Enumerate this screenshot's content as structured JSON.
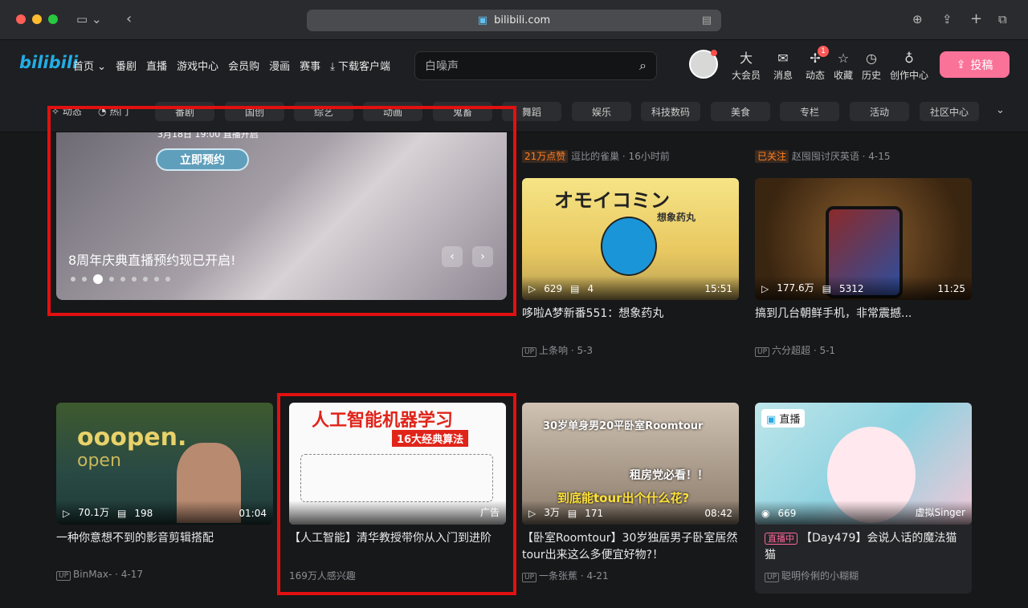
{
  "browser": {
    "url": "bilibili.com"
  },
  "header": {
    "logo": "bilibili",
    "nav": [
      "首页 ⌄",
      "番剧",
      "直播",
      "游戏中心",
      "会员购",
      "漫画",
      "赛事",
      "下载客户端"
    ],
    "search_placeholder": "白噪声",
    "tools": [
      {
        "label": "大会员",
        "icon": "大"
      },
      {
        "label": "消息",
        "icon": "✉"
      },
      {
        "label": "动态",
        "icon": "✢",
        "badge": "1"
      },
      {
        "label": "收藏",
        "icon": "☆"
      },
      {
        "label": "历史",
        "icon": "◷"
      },
      {
        "label": "创作中心",
        "icon": "♁"
      }
    ],
    "upload": "投稿"
  },
  "left_tabs": [
    "动态",
    "热门"
  ],
  "categories": [
    "番剧",
    "国创",
    "综艺",
    "动画",
    "鬼畜",
    "舞蹈",
    "娱乐",
    "科技数码",
    "美食",
    "专栏",
    "活动",
    "社区中心"
  ],
  "banner": {
    "top_text": "3月18日 19:00 直播开启",
    "button": "立即预约",
    "caption": "8周年庆典直播预约现已开启!"
  },
  "top_meta": [
    {
      "tag": "21万点赞",
      "text": "逗比的雀巢 · 16小时前"
    },
    {
      "tag": "已关注",
      "text": "赵囤囤讨厌英语 · 4-15"
    }
  ],
  "cards": [
    {
      "cover": "オモイコミン",
      "sub": "想象药丸",
      "views": "629",
      "danmaku": "4",
      "duration": "15:51",
      "title": "哆啦A梦新番551：想象药丸",
      "up": "上条响 · 5-3"
    },
    {
      "views": "177.6万",
      "danmaku": "5312",
      "duration": "11:25",
      "title": "搞到几台朝鲜手机，非常震撼...",
      "up": "六分超超 · 5-1"
    },
    {
      "cover": "ooopen.",
      "sub": "open",
      "views": "70.1万",
      "danmaku": "198",
      "duration": "01:04",
      "title": "一种你意想不到的影音剪辑搭配",
      "up": "BinMax- · 4-17"
    },
    {
      "cover": "人工智能机器学习",
      "sub": "16大经典算法",
      "ad": "广告",
      "title": "【人工智能】清华教授带你从入门到进阶",
      "up": "169万人感兴趣"
    },
    {
      "cover": "30岁单身男20平卧室Roomtour",
      "sub": "租房党必看！！",
      "sub2": "到底能tour出个什么花?",
      "views": "3万",
      "danmaku": "171",
      "duration": "08:42",
      "title": "【卧室Roomtour】30岁独居男子卧室居然tour出来这么多便宜好物?！",
      "up": "一条张蕉 · 4-21"
    },
    {
      "live": "直播",
      "views": "669",
      "extra": "虚拟Singer",
      "badge": "直播中",
      "title": "【Day479】会说人话的魔法猫猫",
      "up": "聪明伶俐的小糊糊"
    }
  ]
}
